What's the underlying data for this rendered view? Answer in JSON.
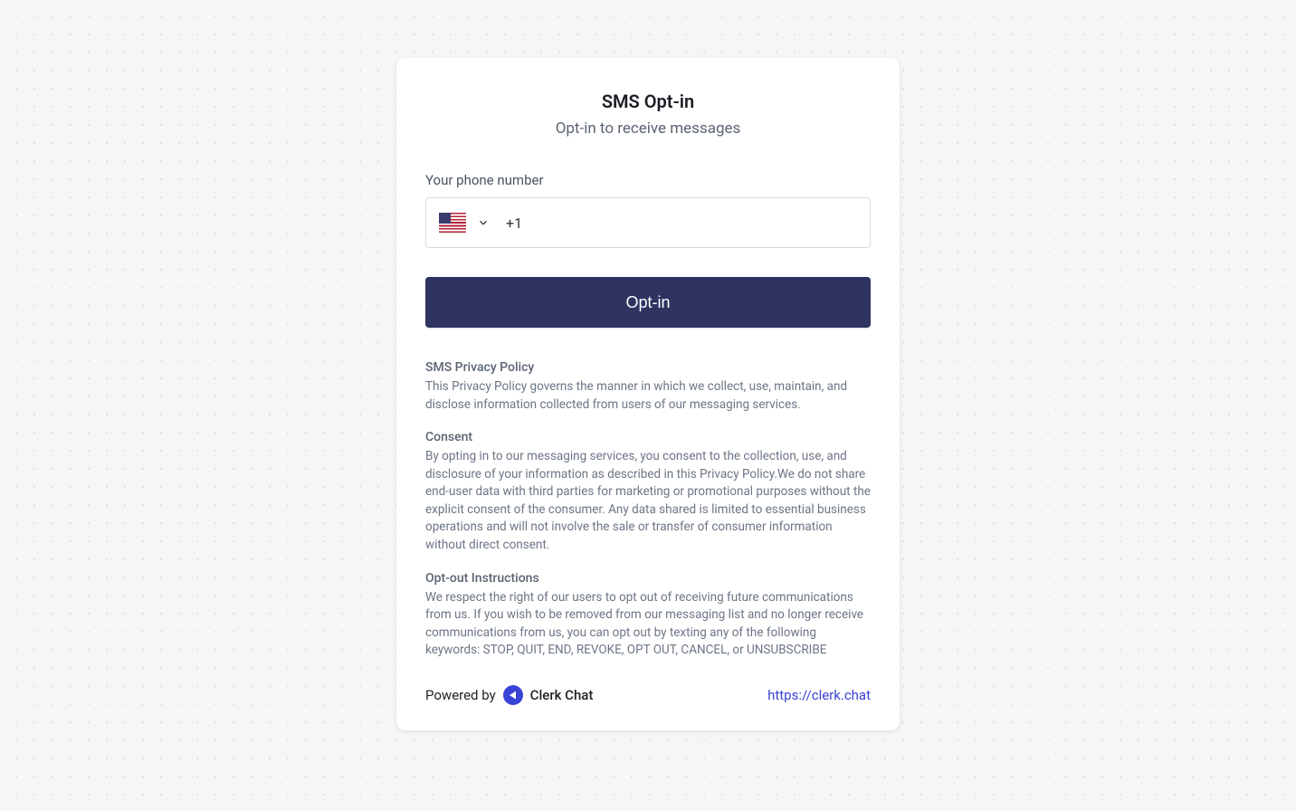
{
  "header": {
    "title": "SMS Opt-in",
    "subtitle": "Opt-in to receive messages"
  },
  "form": {
    "phone_label": "Your phone number",
    "country_code": "+1",
    "phone_value": "",
    "submit_label": "Opt-in"
  },
  "policy": {
    "sections": [
      {
        "heading": "SMS Privacy Policy",
        "body": "This Privacy Policy governs the manner in which we collect, use, maintain, and disclose information collected from users of our messaging services."
      },
      {
        "heading": "Consent",
        "body": "By opting in to our messaging services, you consent to the collection, use, and disclosure of your information as described in this Privacy Policy.We do not share end-user data with third parties for marketing or promotional purposes without the explicit consent of the consumer. Any data shared is limited to essential business operations and will not involve the sale or transfer of consumer information without direct consent."
      },
      {
        "heading": "Opt-out Instructions",
        "body": "We respect the right of our users to opt out of receiving future communications from us. If you wish to be removed from our messaging list and no longer receive communications from us, you can opt out by texting any of the following keywords: STOP, QUIT, END, REVOKE, OPT OUT, CANCEL, or UNSUBSCRIBE"
      }
    ]
  },
  "footer": {
    "powered_by_label": "Powered by",
    "brand_name": "Clerk Chat",
    "link_text": "https://clerk.chat"
  }
}
